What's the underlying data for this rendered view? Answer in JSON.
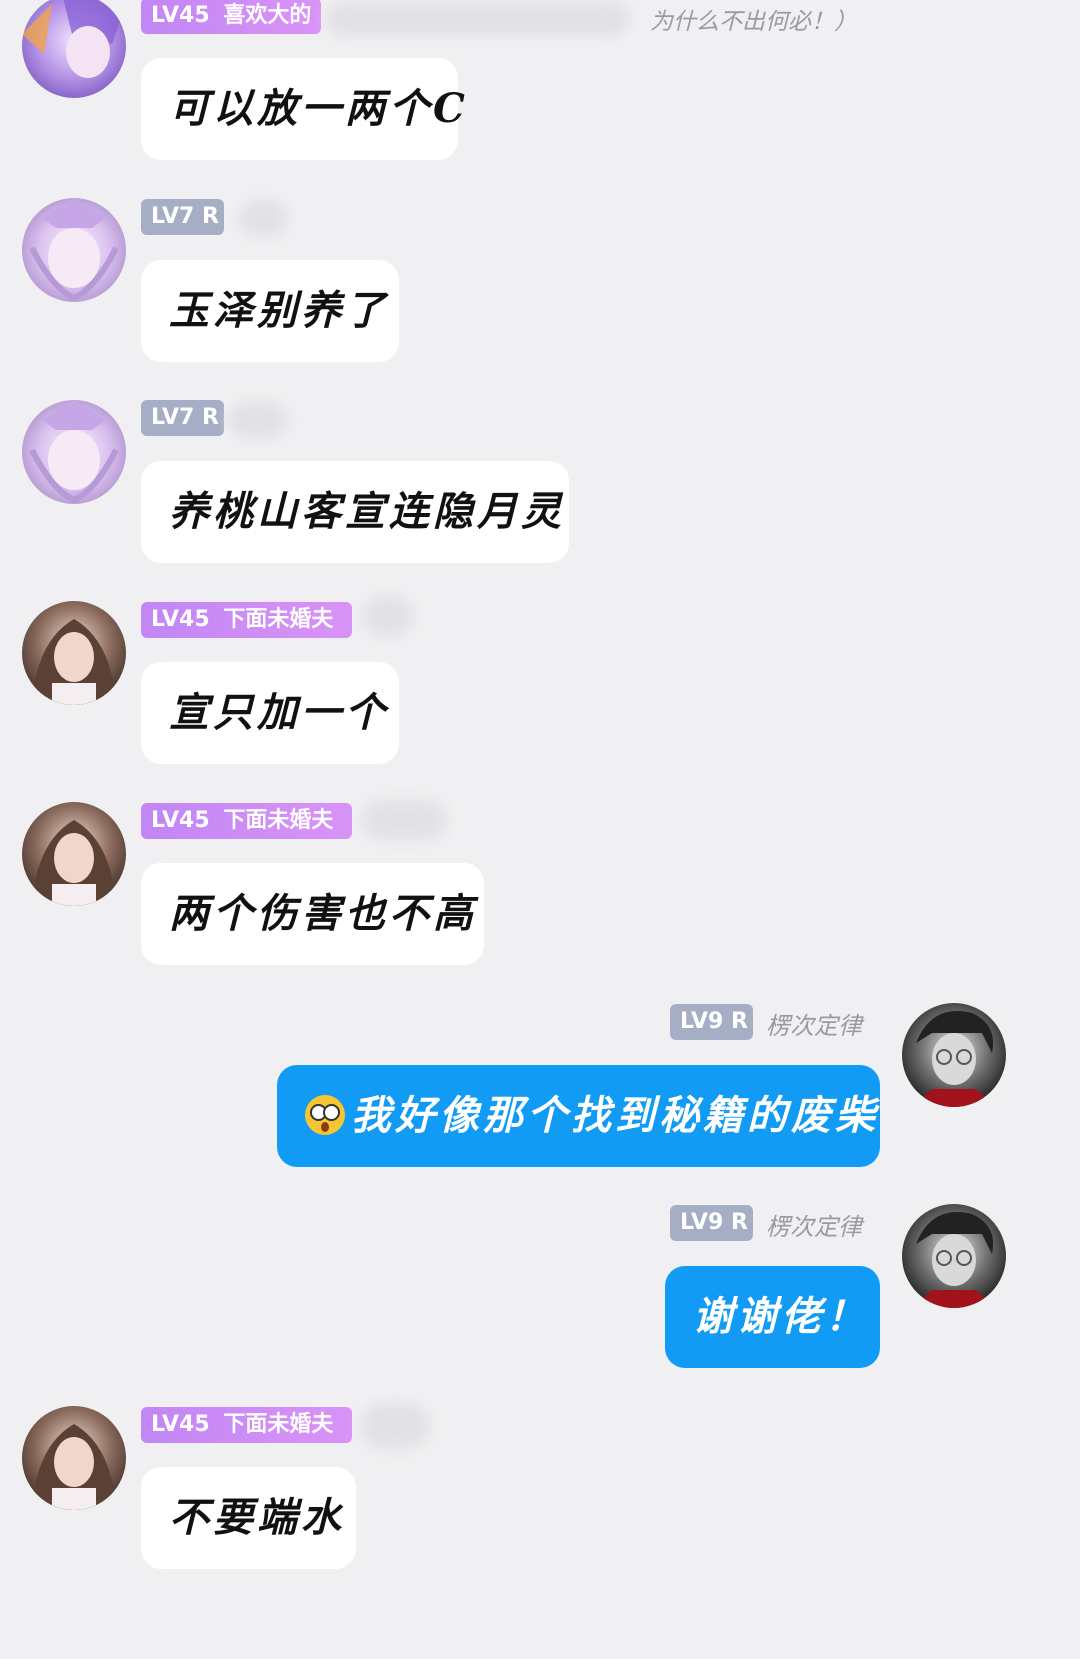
{
  "chat": {
    "top_message_fragment": "为什么不出何必！）",
    "messages": [
      {
        "level": "LV45",
        "title": "喜欢大的",
        "text": "可以放一两个C"
      },
      {
        "level": "LV7 R",
        "text": "玉泽别养了"
      },
      {
        "level": "LV7 R",
        "text": "养桃山客宣连隐月灵"
      },
      {
        "level": "LV45",
        "title": "下面未婚夫",
        "text": "宣只加一个"
      },
      {
        "level": "LV45",
        "title": "下面未婚夫",
        "text": "两个伤害也不高"
      },
      {
        "level": "LV9 R",
        "nickname": "楞次定律",
        "text": "我好像那个找到秘籍的废柴",
        "emoji": "flushed-face-emoji"
      },
      {
        "level": "LV9 R",
        "nickname": "楞次定律",
        "text": "谢谢佬！"
      },
      {
        "level": "LV45",
        "title": "下面未婚夫",
        "text": "不要端水"
      }
    ]
  },
  "colors": {
    "background": "#f0f0f2",
    "bubble_in": "#ffffff",
    "bubble_out": "#129bf5",
    "badge_purple": "#c186f5",
    "badge_gray": "#a6aec6"
  }
}
